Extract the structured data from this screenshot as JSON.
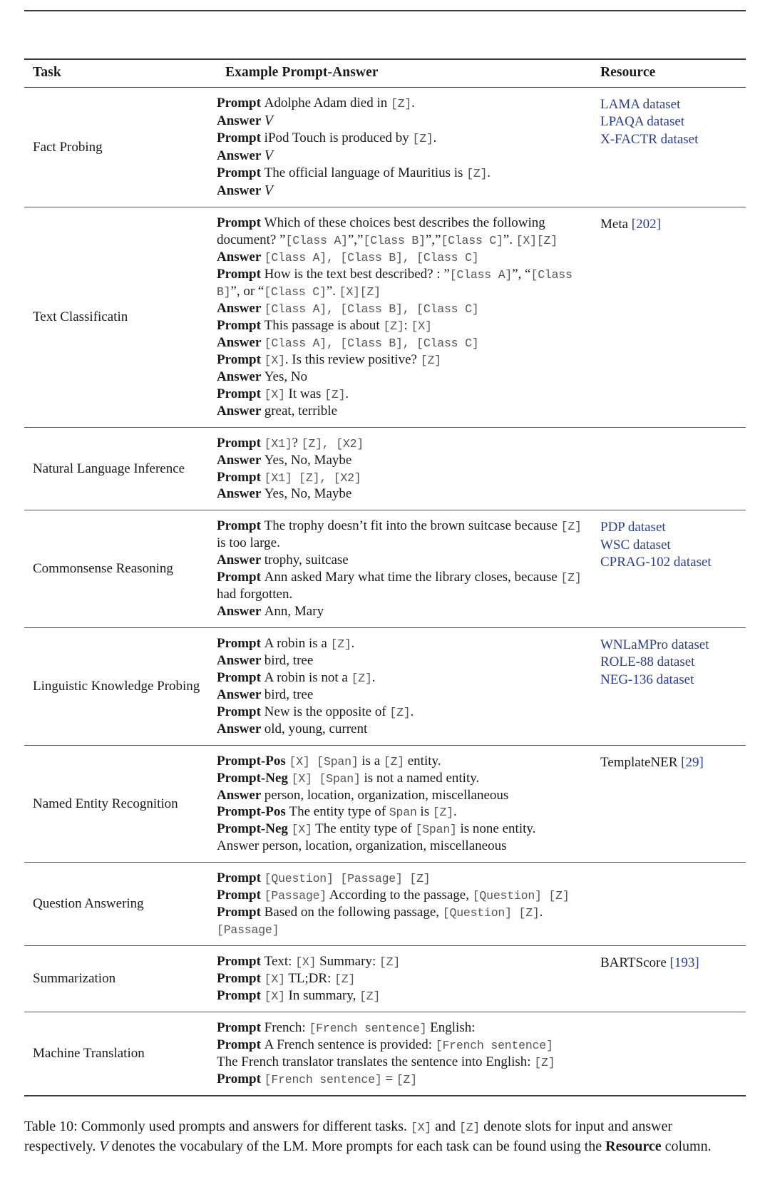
{
  "table": {
    "label": "Table 10",
    "headers": {
      "task": "Task",
      "example": "Example Prompt-Answer",
      "resource": "Resource"
    },
    "rows": [
      {
        "task": "Fact Probing",
        "lines": [
          [
            {
              "t": "Prompt",
              "k": "lbl"
            },
            {
              "t": "Adolphe Adam died in ",
              "k": "txt"
            },
            {
              "t": "[Z]",
              "k": "mono"
            },
            {
              "t": ".",
              "k": "txt"
            }
          ],
          [
            {
              "t": "Answer",
              "k": "lbl"
            },
            {
              "t": "V",
              "k": "cal"
            }
          ],
          [
            {
              "t": "Prompt",
              "k": "lbl"
            },
            {
              "t": "iPod Touch is produced by ",
              "k": "txt"
            },
            {
              "t": "[Z]",
              "k": "mono"
            },
            {
              "t": ".",
              "k": "txt"
            }
          ],
          [
            {
              "t": "Answer",
              "k": "lbl"
            },
            {
              "t": "V",
              "k": "cal"
            }
          ],
          [
            {
              "t": "Prompt",
              "k": "lbl"
            },
            {
              "t": "The official language of Mauritius is ",
              "k": "txt"
            },
            {
              "t": "[Z]",
              "k": "mono"
            },
            {
              "t": ".",
              "k": "txt"
            }
          ],
          [
            {
              "t": "Answer",
              "k": "lbl"
            },
            {
              "t": "V",
              "k": "cal"
            }
          ]
        ],
        "resources": [
          {
            "text": "LAMA dataset",
            "style": "link"
          },
          {
            "text": "LPAQA dataset",
            "style": "link"
          },
          {
            "text": "X-FACTR dataset",
            "style": "link"
          }
        ]
      },
      {
        "task": "Text Classificatin",
        "lines": [
          [
            {
              "t": "Prompt",
              "k": "lbl"
            },
            {
              "t": "Which of these choices best describes the following document? ”",
              "k": "txt"
            },
            {
              "t": "[Class A]",
              "k": "mono"
            },
            {
              "t": "”,”",
              "k": "txt"
            },
            {
              "t": "[Class B]",
              "k": "mono"
            },
            {
              "t": "”,”",
              "k": "txt"
            },
            {
              "t": "[Class C]",
              "k": "mono"
            },
            {
              "t": "”. ",
              "k": "txt"
            },
            {
              "t": "[X][Z]",
              "k": "mono"
            }
          ],
          [
            {
              "t": "Answer",
              "k": "lbl"
            },
            {
              "t": "[Class A]",
              "k": "mono"
            },
            {
              "t": ", ",
              "k": "mono"
            },
            {
              "t": "[Class B]",
              "k": "mono"
            },
            {
              "t": ", ",
              "k": "mono"
            },
            {
              "t": "[Class C]",
              "k": "mono"
            }
          ],
          [
            {
              "t": "Prompt",
              "k": "lbl"
            },
            {
              "t": "How is the text best described? : ”",
              "k": "txt"
            },
            {
              "t": "[Class A]",
              "k": "mono"
            },
            {
              "t": "”, “",
              "k": "txt"
            },
            {
              "t": "[Class B]",
              "k": "mono"
            },
            {
              "t": "”, or “",
              "k": "txt"
            },
            {
              "t": "[Class C]",
              "k": "mono"
            },
            {
              "t": "”. ",
              "k": "txt"
            },
            {
              "t": "[X][Z]",
              "k": "mono"
            }
          ],
          [
            {
              "t": "Answer",
              "k": "lbl"
            },
            {
              "t": "[Class A]",
              "k": "mono"
            },
            {
              "t": ", ",
              "k": "mono"
            },
            {
              "t": "[Class B]",
              "k": "mono"
            },
            {
              "t": ", ",
              "k": "mono"
            },
            {
              "t": "[Class C]",
              "k": "mono"
            }
          ],
          [
            {
              "t": "Prompt",
              "k": "lbl"
            },
            {
              "t": "This passage is about ",
              "k": "txt"
            },
            {
              "t": "[Z]",
              "k": "mono"
            },
            {
              "t": ": ",
              "k": "txt"
            },
            {
              "t": "[X]",
              "k": "mono"
            }
          ],
          [
            {
              "t": "Answer",
              "k": "lbl"
            },
            {
              "t": "[Class A]",
              "k": "mono"
            },
            {
              "t": ", ",
              "k": "mono"
            },
            {
              "t": "[Class B]",
              "k": "mono"
            },
            {
              "t": ", ",
              "k": "mono"
            },
            {
              "t": "[Class C]",
              "k": "mono"
            }
          ],
          [
            {
              "t": "Prompt",
              "k": "lbl"
            },
            {
              "t": "[X]",
              "k": "mono"
            },
            {
              "t": ". Is this review positive? ",
              "k": "txt"
            },
            {
              "t": "[Z]",
              "k": "mono"
            }
          ],
          [
            {
              "t": "Answer",
              "k": "lbl"
            },
            {
              "t": "Yes, No",
              "k": "txt"
            }
          ],
          [
            {
              "t": "Prompt",
              "k": "lbl"
            },
            {
              "t": "[X]",
              "k": "mono"
            },
            {
              "t": " It was ",
              "k": "txt"
            },
            {
              "t": "[Z]",
              "k": "mono"
            },
            {
              "t": ".",
              "k": "txt"
            }
          ],
          [
            {
              "t": "Answer",
              "k": "lbl"
            },
            {
              "t": "great, terrible",
              "k": "txt"
            }
          ]
        ],
        "resources": [
          {
            "text": "Meta ",
            "style": "plain"
          },
          {
            "text": "[202]",
            "style": "ref",
            "inline": true
          }
        ]
      },
      {
        "task": "Natural Language Inference",
        "lines": [
          [
            {
              "t": "Prompt",
              "k": "lbl"
            },
            {
              "t": "[X1]",
              "k": "mono"
            },
            {
              "t": "? ",
              "k": "txt"
            },
            {
              "t": "[Z]",
              "k": "mono"
            },
            {
              "t": ", ",
              "k": "mono"
            },
            {
              "t": "[X2]",
              "k": "mono"
            }
          ],
          [
            {
              "t": "Answer",
              "k": "lbl"
            },
            {
              "t": "Yes, No, Maybe",
              "k": "txt"
            }
          ],
          [
            {
              "t": "Prompt",
              "k": "lbl"
            },
            {
              "t": "[X1] [Z]",
              "k": "mono"
            },
            {
              "t": ", ",
              "k": "mono"
            },
            {
              "t": "[X2]",
              "k": "mono"
            }
          ],
          [
            {
              "t": "Answer",
              "k": "lbl"
            },
            {
              "t": "Yes, No, Maybe",
              "k": "txt"
            }
          ]
        ],
        "resources": []
      },
      {
        "task": "Commonsense Reasoning",
        "lines": [
          [
            {
              "t": "Prompt",
              "k": "lbl"
            },
            {
              "t": "The trophy doesn’t fit into the brown suitcase because ",
              "k": "txt"
            },
            {
              "t": "[Z]",
              "k": "mono"
            },
            {
              "t": " is too large.",
              "k": "txt"
            }
          ],
          [
            {
              "t": "Answer",
              "k": "lbl"
            },
            {
              "t": "trophy, suitcase",
              "k": "txt"
            }
          ],
          [
            {
              "t": "Prompt",
              "k": "lbl"
            },
            {
              "t": "Ann asked Mary what time the library closes, because ",
              "k": "txt"
            },
            {
              "t": "[Z]",
              "k": "mono"
            },
            {
              "t": " had forgotten.",
              "k": "txt"
            }
          ],
          [
            {
              "t": "Answer",
              "k": "lbl"
            },
            {
              "t": "Ann, Mary",
              "k": "txt"
            }
          ]
        ],
        "resources": [
          {
            "text": "PDP dataset",
            "style": "link"
          },
          {
            "text": "WSC dataset",
            "style": "link"
          },
          {
            "text": "CPRAG-102 dataset",
            "style": "link"
          }
        ]
      },
      {
        "task": "Linguistic Knowledge Probing",
        "lines": [
          [
            {
              "t": "Prompt",
              "k": "lbl"
            },
            {
              "t": "A robin is a ",
              "k": "txt"
            },
            {
              "t": "[Z]",
              "k": "mono"
            },
            {
              "t": ".",
              "k": "txt"
            }
          ],
          [
            {
              "t": "Answer",
              "k": "lbl"
            },
            {
              "t": "bird, tree",
              "k": "txt"
            }
          ],
          [
            {
              "t": "Prompt",
              "k": "lbl"
            },
            {
              "t": "A robin is not a ",
              "k": "txt"
            },
            {
              "t": "[Z]",
              "k": "mono"
            },
            {
              "t": ".",
              "k": "txt"
            }
          ],
          [
            {
              "t": "Answer",
              "k": "lbl"
            },
            {
              "t": "bird, tree",
              "k": "txt"
            }
          ],
          [
            {
              "t": "Prompt",
              "k": "lbl"
            },
            {
              "t": "New is the opposite of ",
              "k": "txt"
            },
            {
              "t": "[Z]",
              "k": "mono"
            },
            {
              "t": ".",
              "k": "txt"
            }
          ],
          [
            {
              "t": "Answer",
              "k": "lbl"
            },
            {
              "t": "old, young, current",
              "k": "txt"
            }
          ]
        ],
        "resources": [
          {
            "text": "WNLaMPro dataset",
            "style": "link"
          },
          {
            "text": "ROLE-88 dataset",
            "style": "link"
          },
          {
            "text": "NEG-136 dataset",
            "style": "link"
          }
        ]
      },
      {
        "task": "Named Entity Recognition",
        "lines": [
          [
            {
              "t": "Prompt-Pos",
              "k": "lbl"
            },
            {
              "t": "[X] [Span]",
              "k": "mono"
            },
            {
              "t": " is a ",
              "k": "txt"
            },
            {
              "t": "[Z]",
              "k": "mono"
            },
            {
              "t": " entity.",
              "k": "txt"
            }
          ],
          [
            {
              "t": "Prompt-Neg",
              "k": "lbl"
            },
            {
              "t": "[X] [Span]",
              "k": "mono"
            },
            {
              "t": " is not a named entity.",
              "k": "txt"
            }
          ],
          [
            {
              "t": "Answer",
              "k": "lbl"
            },
            {
              "t": "person, location, organization, miscellaneous",
              "k": "txt"
            }
          ],
          [
            {
              "t": "Prompt-Pos",
              "k": "lbl"
            },
            {
              "t": "The entity type of ",
              "k": "txt"
            },
            {
              "t": "Span",
              "k": "mono"
            },
            {
              "t": " is ",
              "k": "txt"
            },
            {
              "t": "[Z]",
              "k": "mono"
            },
            {
              "t": ".",
              "k": "txt"
            }
          ],
          [
            {
              "t": "Prompt-Neg",
              "k": "lbl"
            },
            {
              "t": "[X]",
              "k": "mono"
            },
            {
              "t": " The entity type of ",
              "k": "txt"
            },
            {
              "t": "[Span]",
              "k": "mono"
            },
            {
              "t": " is none entity.",
              "k": "txt"
            }
          ],
          [
            {
              "t": "Answer person, location, organization, miscellaneous",
              "k": "txt"
            }
          ]
        ],
        "resources": [
          {
            "text": "TemplateNER ",
            "style": "plain"
          },
          {
            "text": "[29]",
            "style": "ref",
            "inline": true
          }
        ]
      },
      {
        "task": "Question Answering",
        "lines": [
          [
            {
              "t": "Prompt",
              "k": "lbl"
            },
            {
              "t": "[Question] [Passage] [Z]",
              "k": "mono"
            }
          ],
          [
            {
              "t": "Prompt",
              "k": "lbl"
            },
            {
              "t": "[Passage]",
              "k": "mono"
            },
            {
              "t": " According to the passage, ",
              "k": "txt"
            },
            {
              "t": "[Question] [Z]",
              "k": "mono"
            }
          ],
          [
            {
              "t": "Prompt",
              "k": "lbl"
            },
            {
              "t": "Based on the following passage, ",
              "k": "txt"
            },
            {
              "t": "[Question] [Z]",
              "k": "mono"
            },
            {
              "t": ". ",
              "k": "txt"
            },
            {
              "t": "[Passage]",
              "k": "mono"
            }
          ]
        ],
        "resources": []
      },
      {
        "task": "Summarization",
        "lines": [
          [
            {
              "t": "Prompt",
              "k": "lbl"
            },
            {
              "t": "Text: ",
              "k": "txt"
            },
            {
              "t": "[X]",
              "k": "mono"
            },
            {
              "t": " Summary: ",
              "k": "txt"
            },
            {
              "t": "[Z]",
              "k": "mono"
            }
          ],
          [
            {
              "t": "Prompt",
              "k": "lbl"
            },
            {
              "t": "[X]",
              "k": "mono"
            },
            {
              "t": " TL;DR: ",
              "k": "txt"
            },
            {
              "t": "[Z]",
              "k": "mono"
            }
          ],
          [
            {
              "t": "Prompt",
              "k": "lbl"
            },
            {
              "t": "[X]",
              "k": "mono"
            },
            {
              "t": " In summary, ",
              "k": "txt"
            },
            {
              "t": "[Z]",
              "k": "mono"
            }
          ]
        ],
        "resources": [
          {
            "text": "BARTScore ",
            "style": "plain"
          },
          {
            "text": "[193]",
            "style": "ref",
            "inline": true
          }
        ]
      },
      {
        "task": "Machine Translation",
        "lines": [
          [
            {
              "t": "Prompt",
              "k": "lbl"
            },
            {
              "t": "French: ",
              "k": "txt"
            },
            {
              "t": "[French sentence]",
              "k": "mono"
            },
            {
              "t": " English:",
              "k": "txt"
            }
          ],
          [
            {
              "t": "Prompt",
              "k": "lbl"
            },
            {
              "t": "A French sentence is provided: ",
              "k": "txt"
            },
            {
              "t": "[French sentence]",
              "k": "mono"
            }
          ],
          [
            {
              "t": "The French translator translates the sentence into English: ",
              "k": "txt"
            },
            {
              "t": "[Z]",
              "k": "mono"
            }
          ],
          [
            {
              "t": "Prompt",
              "k": "lbl"
            },
            {
              "t": "[French sentence]",
              "k": "mono"
            },
            {
              "t": " = ",
              "k": "txt"
            },
            {
              "t": "[Z]",
              "k": "mono"
            }
          ]
        ],
        "resources": []
      }
    ]
  },
  "caption": {
    "parts": [
      {
        "t": "Table 10:  Commonly used prompts and answers for different tasks. ",
        "k": "txt"
      },
      {
        "t": "[X]",
        "k": "mono"
      },
      {
        "t": " and ",
        "k": "txt"
      },
      {
        "t": "[Z]",
        "k": "mono"
      },
      {
        "t": " denote slots for input and answer respectively. ",
        "k": "txt"
      },
      {
        "t": "V",
        "k": "cal"
      },
      {
        "t": " denotes the vocabulary of the LM. More prompts for each task can be found using the ",
        "k": "txt"
      },
      {
        "t": "Resource",
        "k": "lbl"
      },
      {
        "t": " column.",
        "k": "txt"
      }
    ]
  },
  "colors": {
    "link": "#2c3e8f",
    "mono": "#545454",
    "rule": "#3a3a3a",
    "text": "#1a1a1a"
  }
}
